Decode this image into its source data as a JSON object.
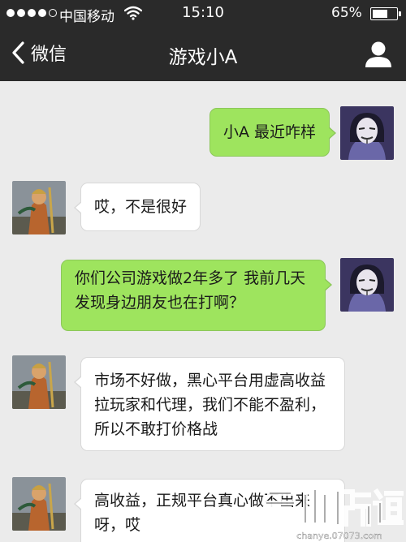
{
  "status_bar": {
    "carrier": "中国移动",
    "time": "15:10",
    "battery_percent": "65%",
    "battery_level": 0.65,
    "signal_bars": 4,
    "signal_max": 5
  },
  "nav": {
    "back_label": "微信",
    "title": "游戏小A",
    "profile_icon": "person-icon"
  },
  "messages": [
    {
      "from": "me",
      "text": "小A 最近咋样"
    },
    {
      "from": "contact",
      "text": "哎，不是很好"
    },
    {
      "from": "me",
      "text": "你们公司游戏做2年多了 我前几天发现身边朋友也在打啊？"
    },
    {
      "from": "contact",
      "text": "市场不好做，黑心平台用虚高收益拉玩家和代理，我们不能不盈利，所以不敢打价格战"
    },
    {
      "from": "contact",
      "text": "高收益，正规平台真心做不出来呀，哎"
    }
  ],
  "watermark": {
    "brand": "产业频道",
    "url": "chanye.07073.com"
  },
  "colors": {
    "bar": "#2a2a2a",
    "background": "#ebebeb",
    "sent_bubble": "#9ee45e",
    "received_bubble": "#ffffff"
  }
}
